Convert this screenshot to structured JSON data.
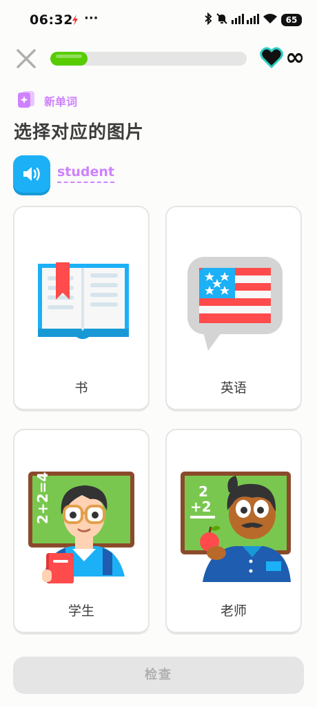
{
  "status_bar": {
    "time": "06:32",
    "dots": "···",
    "battery": "65"
  },
  "lesson": {
    "progress": 0.19,
    "hearts": "∞",
    "badge_label": "新单词",
    "title": "选择对应的图片",
    "word": "student"
  },
  "choices": [
    {
      "label": "书",
      "icon": "book-icon"
    },
    {
      "label": "英语",
      "icon": "us-flag-speech-icon"
    },
    {
      "label": "学生",
      "icon": "student-icon"
    },
    {
      "label": "老师",
      "icon": "teacher-icon"
    }
  ],
  "check_button": "检查",
  "colors": {
    "accent_green": "#58CC02",
    "accent_blue": "#1CB0F6",
    "accent_purple": "#CE82FF",
    "heart_outline": "#2BCDC2"
  }
}
